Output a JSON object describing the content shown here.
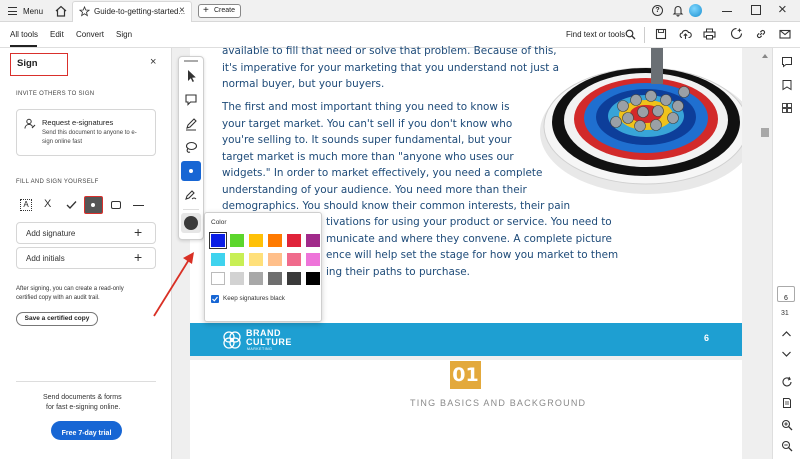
{
  "topbar": {
    "menu_label": "Menu",
    "doc_tab_title": "Guide-to-getting-started...",
    "create_label": "Create"
  },
  "menubar": {
    "items": [
      "All tools",
      "Edit",
      "Convert",
      "Sign"
    ],
    "find_label": "Find text or tools"
  },
  "leftpanel": {
    "title": "Sign",
    "invite_heading": "INVITE OTHERS TO SIGN",
    "request_title": "Request e-signatures",
    "request_desc_1": "Send this document to anyone to e-",
    "request_desc_2": "sign online fast",
    "fill_heading": "FILL AND SIGN YOURSELF",
    "add_signature": "Add signature",
    "add_initials": "Add initials",
    "certified_text_1": "After signing, you can create a read-only",
    "certified_text_2": "certified copy with an audit trail.",
    "certified_button": "Save a certified copy",
    "promo_1": "Send documents & forms",
    "promo_2": "for fast e-signing online.",
    "trial_button": "Free 7-day trial"
  },
  "document": {
    "para1": [
      "available to fill that need or solve that problem. Because of this,",
      "it's imperative for your marketing that you understand not just a",
      "normal buyer, but your buyers."
    ],
    "para2_left": [
      "The first and most important thing you need to know is",
      "your target market. You can't sell if you don't know who",
      "you're selling to. It sounds super fundamental, but your",
      "target market is much more than \"anyone who uses our",
      "widgets.\" In order to market effectively, you need a complete",
      "understanding of your audience. You need more than their",
      "demographics. You should know their common interests, their pain"
    ],
    "para2_right": [
      "tivations for using your product or service. You need to",
      "municate and where they convene. A complete picture",
      "ence will help set the stage for how you market to them",
      "ing their paths to purchase."
    ],
    "footer_brand_1": "BRAND",
    "footer_brand_2": "CULTURE",
    "footer_brand_3": "MARKETING",
    "page_number": "6",
    "chapter_number": "01",
    "chapter_title": "TING BASICS AND BACKGROUND"
  },
  "colorpop": {
    "label": "Color",
    "keep_black_label": "Keep signatures black",
    "colors": [
      "#0a1ee6",
      "#5cd62c",
      "#ffc107",
      "#ff7a00",
      "#e0233a",
      "#a12a8a",
      "#3fd3ee",
      "#c8ef55",
      "#ffe07a",
      "#ffbf8a",
      "#f06b8c",
      "#ee74d9",
      "#ffffff",
      "#d2d2d2",
      "#a8a8a8",
      "#6e6e6e",
      "#3a3a3a",
      "#000000"
    ]
  },
  "rightrail": {
    "page_current": "6",
    "page_total": "31"
  },
  "accent": "#1b9ad6",
  "brand_bar": "#1e9fd2",
  "signal_red": "#d93025"
}
